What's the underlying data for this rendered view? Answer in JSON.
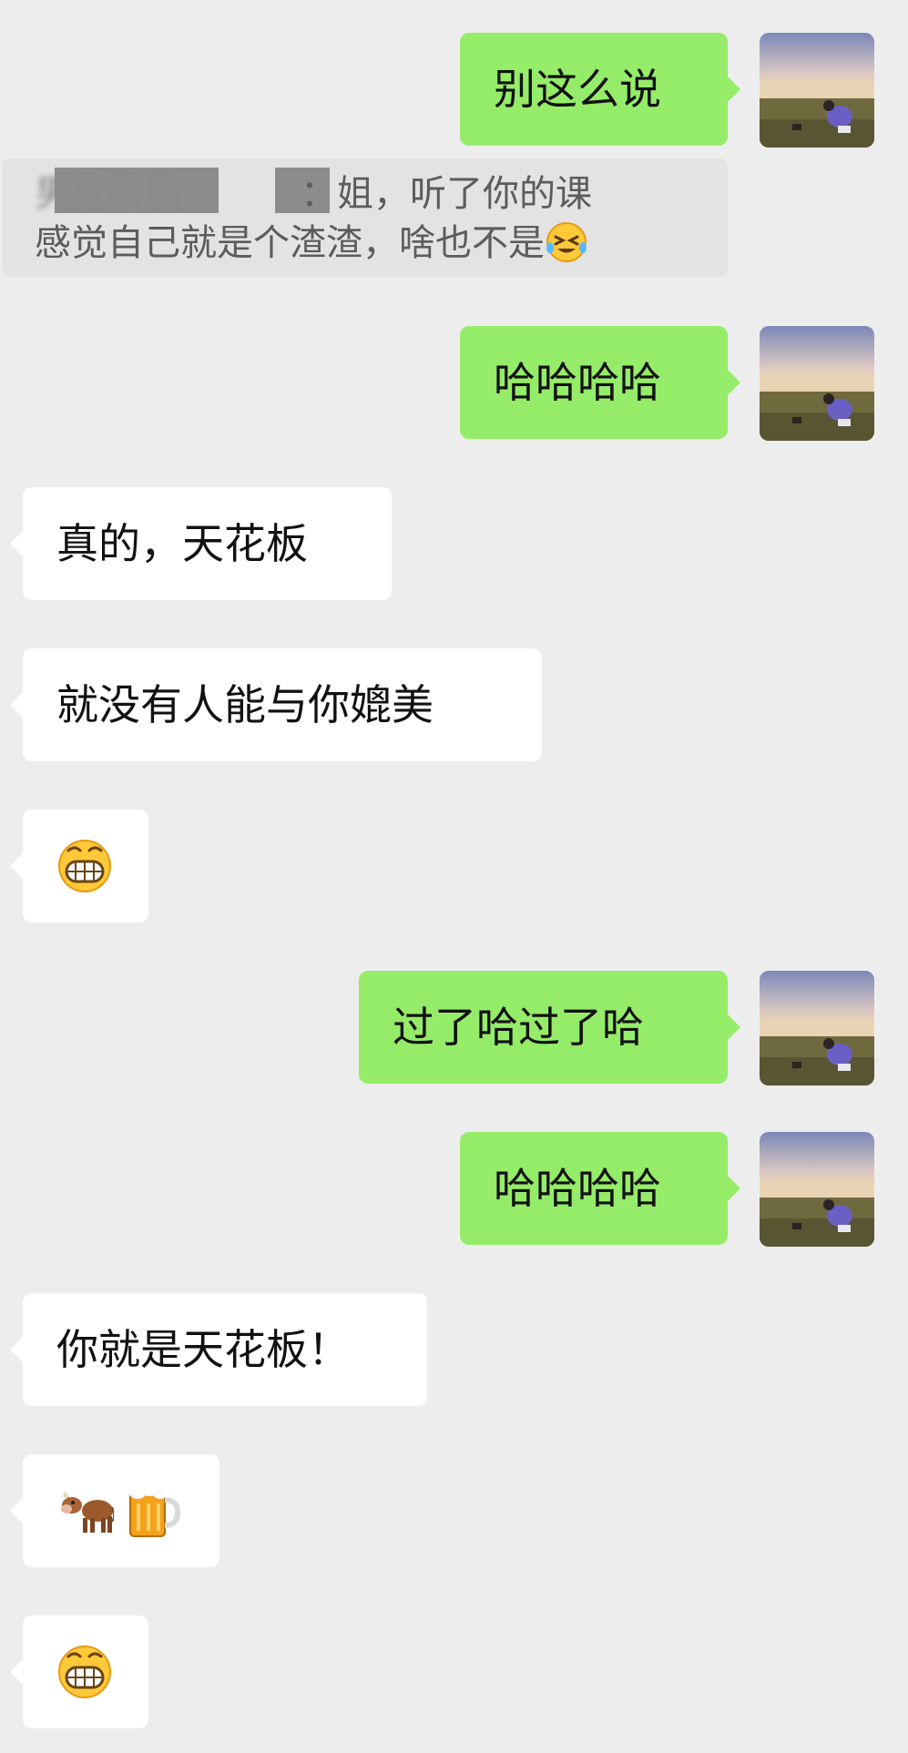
{
  "colors": {
    "background": "#ededed",
    "outgoing_bubble": "#95ec69",
    "incoming_bubble": "#ffffff",
    "quote_background": "#e3e3e3"
  },
  "messages": [
    {
      "id": "m1",
      "direction": "outgoing",
      "text": "别这么说",
      "avatar": "landscape-avatar"
    },
    {
      "id": "q1",
      "direction": "outgoing-quote",
      "sender": "男歌指指",
      "text": "姐，听了你的课感觉自己就是个渣渣，啥也不是",
      "trailing_emoji": "tears-of-laughter-emoji"
    },
    {
      "id": "m2",
      "direction": "outgoing",
      "text": "哈哈哈哈",
      "avatar": "landscape-avatar"
    },
    {
      "id": "m3",
      "direction": "incoming",
      "text": "真的，天花板"
    },
    {
      "id": "m4",
      "direction": "incoming",
      "text": "就没有人能与你媲美"
    },
    {
      "id": "m5",
      "direction": "incoming",
      "emoji": "grinning-face-emoji"
    },
    {
      "id": "m6",
      "direction": "outgoing",
      "text": "过了哈过了哈",
      "avatar": "landscape-avatar"
    },
    {
      "id": "m7",
      "direction": "outgoing",
      "text": "哈哈哈哈",
      "avatar": "landscape-avatar"
    },
    {
      "id": "m8",
      "direction": "incoming",
      "text": "你就是天花板！"
    },
    {
      "id": "m9",
      "direction": "incoming",
      "emoji": [
        "cow-emoji",
        "beer-mug-emoji"
      ]
    },
    {
      "id": "m10",
      "direction": "incoming",
      "emoji": "grinning-face-emoji"
    }
  ],
  "quote": {
    "line1_rest": "姐，听了你的课",
    "line2": "感觉自己就是个渣渣，啥也不是"
  },
  "text": {
    "m1": "别这么说",
    "m2": "哈哈哈哈",
    "m3": "真的，天花板",
    "m4": "就没有人能与你媲美",
    "m6": "过了哈过了哈",
    "m7": "哈哈哈哈",
    "m8": "你就是天花板！"
  }
}
